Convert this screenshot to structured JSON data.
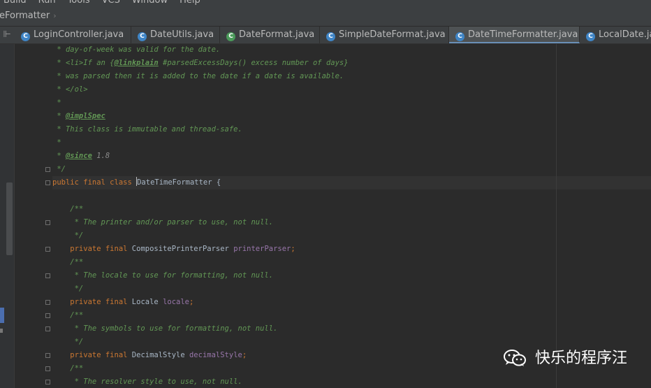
{
  "menubar": {
    "items": [
      "Build",
      "Run",
      "Tools",
      "VCS",
      "Window",
      "Help"
    ]
  },
  "navbar": {
    "crumb": "eFormatter",
    "arrow": "›"
  },
  "tabs": [
    {
      "label": "LoginController.java",
      "icon": "class-icon",
      "close": "×"
    },
    {
      "label": "DateUtils.java",
      "icon": "class-icon",
      "close": "×"
    },
    {
      "label": "DateFormat.java",
      "icon": "abstract-class-icon",
      "close": "×"
    },
    {
      "label": "SimpleDateFormat.java",
      "icon": "class-icon",
      "close": "×"
    },
    {
      "label": "DateTimeFormatter.java",
      "icon": "final-class-icon",
      "close": "×",
      "active": true
    },
    {
      "label": "LocalDate.java",
      "icon": "final-class-icon",
      "close": ""
    }
  ],
  "split_icon": "⊩",
  "code_lines": [
    {
      "parts": [
        [
          "doc",
          " * day-of-week was valid for the date."
        ]
      ]
    },
    {
      "parts": [
        [
          "doc",
          " * <li>If an {"
        ],
        [
          "tag",
          "@linkplain"
        ],
        [
          "doc",
          " #parsedExcessDays() excess number of days}"
        ]
      ]
    },
    {
      "parts": [
        [
          "doc",
          " * was parsed then it is added to the date if a date is available."
        ]
      ]
    },
    {
      "parts": [
        [
          "doc",
          " * </ol>"
        ]
      ]
    },
    {
      "parts": [
        [
          "doc",
          " *"
        ]
      ]
    },
    {
      "parts": [
        [
          "doc",
          " * "
        ],
        [
          "tag",
          "@implSpec"
        ]
      ]
    },
    {
      "parts": [
        [
          "doc",
          " * This class is immutable and thread-safe."
        ]
      ]
    },
    {
      "parts": [
        [
          "doc",
          " *"
        ]
      ]
    },
    {
      "parts": [
        [
          "doc",
          " * "
        ],
        [
          "tag",
          "@since"
        ],
        [
          "doc-plain",
          " 1.8"
        ]
      ]
    },
    {
      "parts": [
        [
          "doc",
          " */"
        ]
      ]
    },
    {
      "parts": [
        [
          "kw",
          "public final class "
        ],
        [
          "plain",
          "DateTimeFormatter {"
        ]
      ],
      "caret": true
    },
    {
      "parts": []
    },
    {
      "parts": [
        [
          "doc",
          "    /**"
        ]
      ]
    },
    {
      "parts": [
        [
          "doc",
          "     * The printer and/or parser to use, not null."
        ]
      ]
    },
    {
      "parts": [
        [
          "doc",
          "     */"
        ]
      ]
    },
    {
      "parts": [
        [
          "kw",
          "    private final "
        ],
        [
          "plain",
          "CompositePrinterParser "
        ],
        [
          "fld",
          "printerParser"
        ],
        [
          "kw",
          ";"
        ]
      ]
    },
    {
      "parts": [
        [
          "doc",
          "    /**"
        ]
      ]
    },
    {
      "parts": [
        [
          "doc",
          "     * The locale to use for formatting, not null."
        ]
      ]
    },
    {
      "parts": [
        [
          "doc",
          "     */"
        ]
      ]
    },
    {
      "parts": [
        [
          "kw",
          "    private final "
        ],
        [
          "plain",
          "Locale "
        ],
        [
          "fld",
          "locale"
        ],
        [
          "kw",
          ";"
        ]
      ]
    },
    {
      "parts": [
        [
          "doc",
          "    /**"
        ]
      ]
    },
    {
      "parts": [
        [
          "doc",
          "     * The symbols to use for formatting, not null."
        ]
      ]
    },
    {
      "parts": [
        [
          "doc",
          "     */"
        ]
      ]
    },
    {
      "parts": [
        [
          "kw",
          "    private final "
        ],
        [
          "plain",
          "DecimalStyle "
        ],
        [
          "fld",
          "decimalStyle"
        ],
        [
          "kw",
          ";"
        ]
      ]
    },
    {
      "parts": [
        [
          "doc",
          "    /**"
        ]
      ]
    },
    {
      "parts": [
        [
          "doc",
          "     * The resolver style to use, not null."
        ]
      ]
    }
  ],
  "fold_lines": [
    10,
    13,
    15,
    17,
    19,
    20,
    21,
    23,
    24,
    25
  ],
  "watermark": {
    "text": "快乐的程序汪",
    "icon": "wechat-icon"
  },
  "colors": {
    "background": "#2b2b2b",
    "doc_comment": "#629755",
    "keyword": "#cc7832",
    "field": "#9876aa",
    "identifier": "#a9b7c6",
    "active_tab": "#4e5254"
  }
}
